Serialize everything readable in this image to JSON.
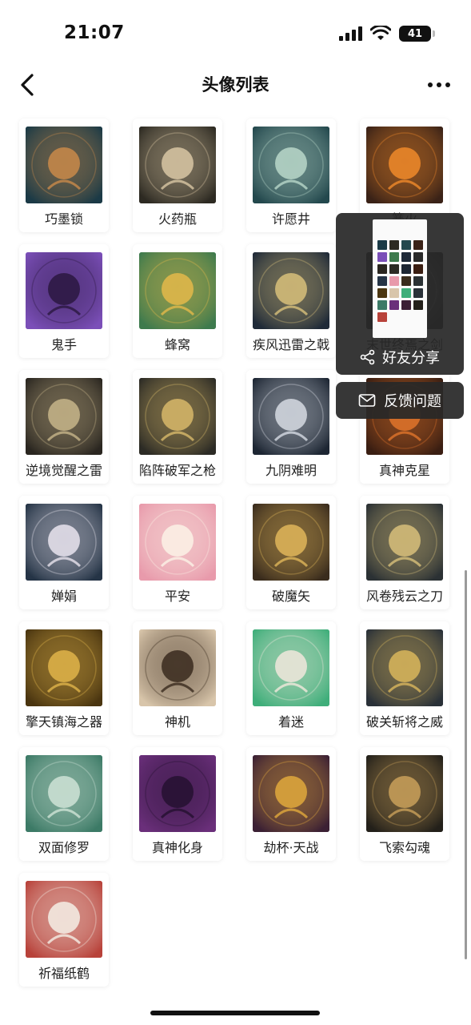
{
  "status_bar": {
    "time": "21:07",
    "battery": "41"
  },
  "header": {
    "title": "头像列表"
  },
  "avatars": [
    {
      "label": "巧墨锁",
      "icon": "lock-icon",
      "bg": "#1b3a46",
      "fg": "#c98a4a"
    },
    {
      "label": "火药瓶",
      "icon": "vase-icon",
      "bg": "#2d2a22",
      "fg": "#d9c7a4"
    },
    {
      "label": "许愿井",
      "icon": "well-icon",
      "bg": "#23484d",
      "fg": "#b8d7c9"
    },
    {
      "label": "篝火",
      "icon": "bonfire-icon",
      "bg": "#3a2217",
      "fg": "#f08a2a"
    },
    {
      "label": "鬼手",
      "icon": "ghost-hand-icon",
      "bg": "#7b4fb8",
      "fg": "#2a1840"
    },
    {
      "label": "蜂窝",
      "icon": "beehive-icon",
      "bg": "#3e7a4d",
      "fg": "#e4b94a"
    },
    {
      "label": "疾风迅雷之戟",
      "icon": "halberd-icon",
      "bg": "#1f2a38",
      "fg": "#d8c07a"
    },
    {
      "label": "末世终焉之剑",
      "icon": "sword-icon",
      "bg": "#2a2a2a",
      "fg": "#c9c9c9"
    },
    {
      "label": "逆境觉醒之雷",
      "icon": "thunder-cannon-icon",
      "bg": "#2a2620",
      "fg": "#c7b58a"
    },
    {
      "label": "陷阵破军之枪",
      "icon": "spear-icon",
      "bg": "#2c2b25",
      "fg": "#d8b96a"
    },
    {
      "label": "九阴难明",
      "icon": "dragon-icon",
      "bg": "#1d2633",
      "fg": "#d6dbe3"
    },
    {
      "label": "真神克星",
      "icon": "fire-dragon-icon",
      "bg": "#3a1e12",
      "fg": "#e0742a"
    },
    {
      "label": "婵娟",
      "icon": "moon-rabbit-icon",
      "bg": "#253446",
      "fg": "#e9e4ee"
    },
    {
      "label": "平安",
      "icon": "rabbit-icon",
      "bg": "#e89aab",
      "fg": "#fbf2e6"
    },
    {
      "label": "破魔矢",
      "icon": "arrow-charm-icon",
      "bg": "#3a2c1d",
      "fg": "#e0b65a"
    },
    {
      "label": "风卷残云之刀",
      "icon": "blade-icon",
      "bg": "#2b3134",
      "fg": "#d8c07a"
    },
    {
      "label": "擎天镇海之器",
      "icon": "golden-pillar-icon",
      "bg": "#4a3510",
      "fg": "#e0b44a"
    },
    {
      "label": "神机",
      "icon": "girl-goggles-icon",
      "bg": "#d8c5aa",
      "fg": "#3a2a1e"
    },
    {
      "label": "着迷",
      "icon": "masked-face-icon",
      "bg": "#3fae7a",
      "fg": "#f1e8dc"
    },
    {
      "label": "破关斩将之威",
      "icon": "glaive-icon",
      "bg": "#2a3138",
      "fg": "#d9b65c"
    },
    {
      "label": "双面修罗",
      "icon": "asura-icon",
      "bg": "#3c7a66",
      "fg": "#cfe3d6"
    },
    {
      "label": "真神化身",
      "icon": "demon-mask-icon",
      "bg": "#6a2f7a",
      "fg": "#241030"
    },
    {
      "label": "劫杯·天战",
      "icon": "gold-dragon-icon",
      "bg": "#3b2034",
      "fg": "#e1a93c"
    },
    {
      "label": "飞索勾魂",
      "icon": "hook-icon",
      "bg": "#23201a",
      "fg": "#c9a05a"
    },
    {
      "label": "祈福纸鹤",
      "icon": "paper-crane-icon",
      "bg": "#b8423a",
      "fg": "#f4efe6"
    }
  ],
  "popover": {
    "share_label": "好友分享",
    "feedback_label": "反馈问题"
  },
  "colors": {
    "popover_bg": "#282828",
    "text": "#222222"
  }
}
